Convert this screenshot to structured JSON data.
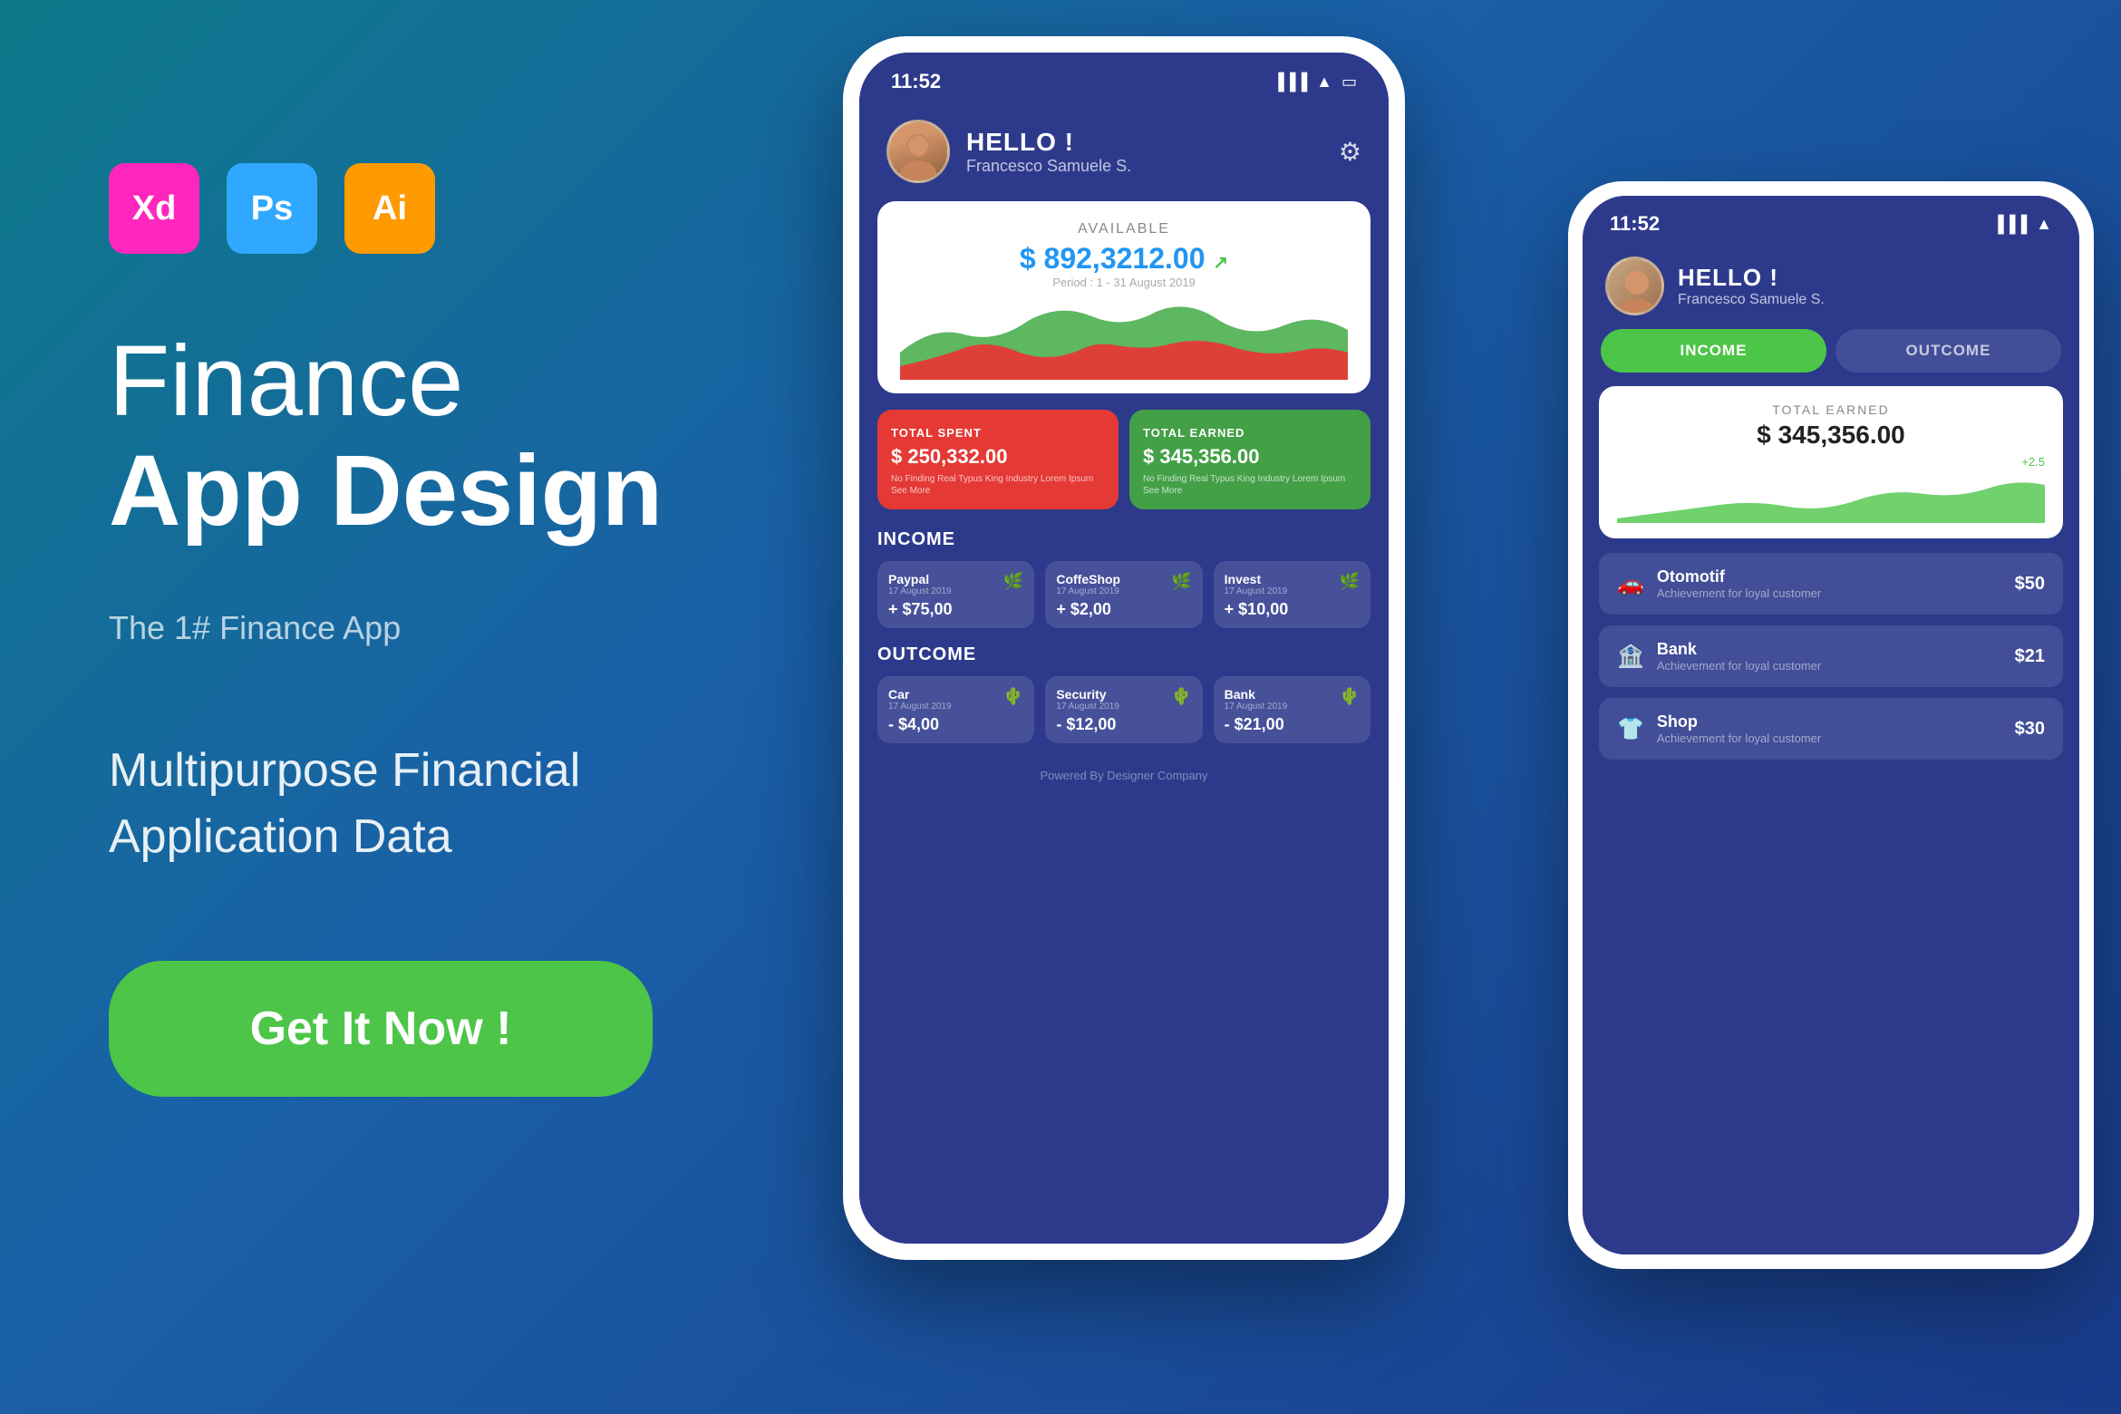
{
  "background": {
    "gradient_start": "#0d7a8a",
    "gradient_end": "#1a3a8a"
  },
  "left": {
    "tools": [
      {
        "label": "Xd",
        "color": "#FF26BE",
        "name": "Adobe XD"
      },
      {
        "label": "Ps",
        "color": "#31A8FF",
        "name": "Photoshop"
      },
      {
        "label": "Ai",
        "color": "#FF9A00",
        "name": "Illustrator"
      }
    ],
    "title_light": "Finance",
    "title_bold": "App Design",
    "subtitle_small": "The 1# Finance App",
    "subtitle_large": "Multipurpose Financial\nApplication Data",
    "cta_button": "Get It Now !"
  },
  "phone_main": {
    "status_time": "11:52",
    "greeting": "HELLO !",
    "user_name": "Francesco Samuele S.",
    "available_label": "AVAILABLE",
    "balance_amount": "$ 892,3212.00",
    "balance_period": "Period : 1 - 31 August 2019",
    "total_spent_label": "TOTAL SPENT",
    "total_spent_amount": "$ 250,332.00",
    "total_spent_desc": "No Finding Real Typus King Industry Lorem Ipsum See More",
    "total_earned_label": "TOTAL EARNED",
    "total_earned_amount": "$ 345,356.00",
    "total_earned_desc": "No Finding Real Typus King Industry Lorem Ipsum See More",
    "income_title": "INCOME",
    "income_items": [
      {
        "name": "Paypal",
        "date": "17 August 2019",
        "amount": "+ $75,00",
        "icon": "🌿"
      },
      {
        "name": "CoffeShop",
        "date": "17 August 2019",
        "amount": "+ $2,00",
        "icon": "🌿"
      },
      {
        "name": "Invest",
        "date": "17 August 2019",
        "amount": "+ $10,00",
        "icon": "🌿"
      }
    ],
    "outcome_title": "OUTCOME",
    "outcome_items": [
      {
        "name": "Car",
        "date": "17 August 2019",
        "amount": "- $4,00",
        "icon": "🌵"
      },
      {
        "name": "Security",
        "date": "17 August 2019",
        "amount": "- $12,00",
        "icon": "🌵"
      },
      {
        "name": "Bank",
        "date": "17 August 2019",
        "amount": "- $21,00",
        "icon": "🌵"
      }
    ],
    "powered_text": "Powered By Designer Company"
  },
  "phone_second": {
    "status_time": "11:52",
    "greeting": "HELLO !",
    "user_name": "Francesco Samuele S.",
    "tab_income": "INCOME",
    "tab_outcome": "OUTCOME",
    "total_earned_label": "TOTAL EARNED",
    "total_earned_amount": "$ 345,356.00",
    "total_earned_change": "+2.5",
    "list_items": [
      {
        "name": "Otomotif",
        "sub": "Achievement for loyal customer",
        "amount": "$50",
        "icon": "🚗"
      },
      {
        "name": "Bank",
        "sub": "Achievement for loyal customer",
        "amount": "$21",
        "icon": "🏦"
      },
      {
        "name": "Shop",
        "sub": "Achievement for loyal customer",
        "amount": "$30",
        "icon": "👕"
      }
    ]
  }
}
